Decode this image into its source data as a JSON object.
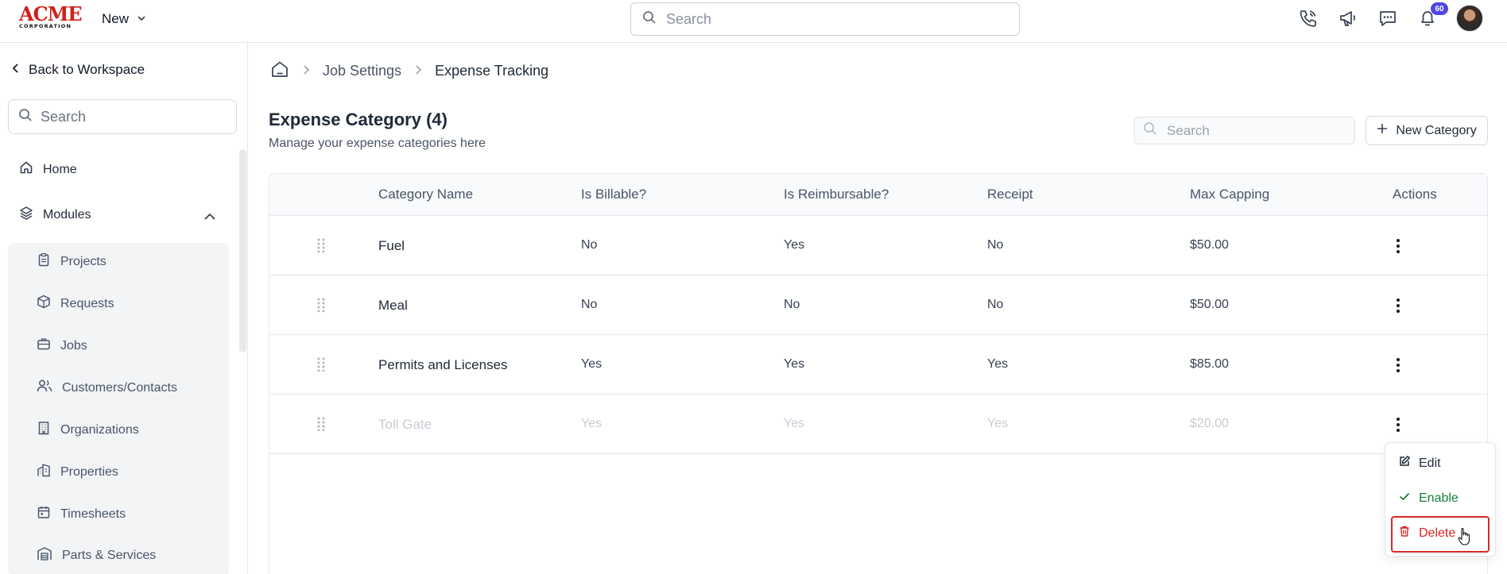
{
  "topbar": {
    "logo_text": "ACME",
    "logo_sub": "CORPORATION",
    "new_label": "New",
    "search_placeholder": "Search",
    "notification_count": "60"
  },
  "sidebar": {
    "back_label": "Back to Workspace",
    "search_placeholder": "Search",
    "home_label": "Home",
    "modules_label": "Modules",
    "modules": [
      {
        "label": "Projects",
        "icon": "clipboard-icon"
      },
      {
        "label": "Requests",
        "icon": "box-icon"
      },
      {
        "label": "Jobs",
        "icon": "briefcase-icon"
      },
      {
        "label": "Customers/Contacts",
        "icon": "users-icon"
      },
      {
        "label": "Organizations",
        "icon": "building-icon"
      },
      {
        "label": "Properties",
        "icon": "buildings-icon"
      },
      {
        "label": "Timesheets",
        "icon": "calendar-icon"
      },
      {
        "label": "Parts & Services",
        "icon": "warehouse-icon"
      }
    ]
  },
  "breadcrumb": {
    "items": [
      "Job Settings",
      "Expense Tracking"
    ]
  },
  "header": {
    "title": "Expense Category (4)",
    "subtitle": "Manage your expense categories here",
    "search_placeholder": "Search",
    "new_button_label": "New Category"
  },
  "table": {
    "columns": [
      "Category Name",
      "Is Billable?",
      "Is Reimbursable?",
      "Receipt",
      "Max Capping",
      "Actions"
    ],
    "rows": [
      {
        "name": "Fuel",
        "billable": "No",
        "reimbursable": "Yes",
        "receipt": "No",
        "max": "$50.00",
        "disabled": false
      },
      {
        "name": "Meal",
        "billable": "No",
        "reimbursable": "No",
        "receipt": "No",
        "max": "$50.00",
        "disabled": false
      },
      {
        "name": "Permits and Licenses",
        "billable": "Yes",
        "reimbursable": "Yes",
        "receipt": "Yes",
        "max": "$85.00",
        "disabled": false
      },
      {
        "name": "Toll Gate",
        "billable": "Yes",
        "reimbursable": "Yes",
        "receipt": "Yes",
        "max": "$20.00",
        "disabled": true
      }
    ]
  },
  "menu": {
    "edit_label": "Edit",
    "enable_label": "Enable",
    "delete_label": "Delete"
  },
  "colors": {
    "brand": "#d0211c",
    "badge": "#4f46e5",
    "enable": "#15803d",
    "delete": "#dc2626"
  }
}
